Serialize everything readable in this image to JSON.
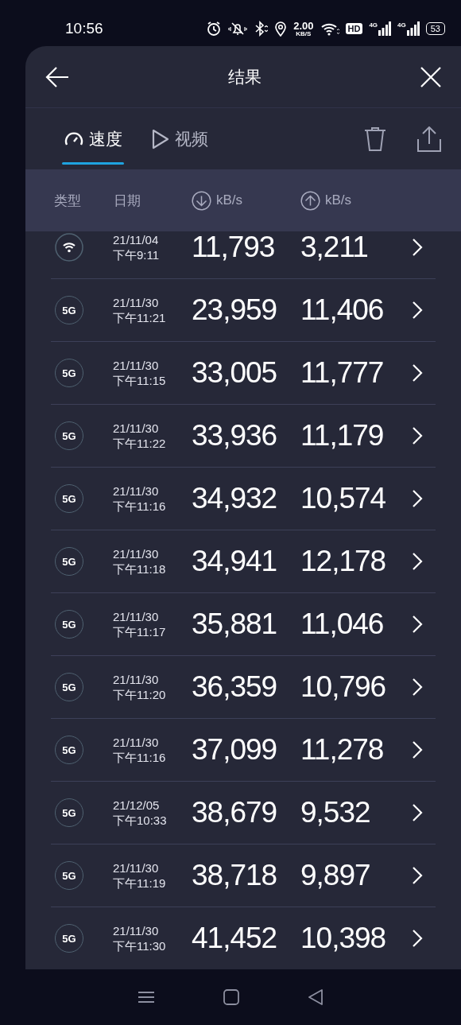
{
  "status_bar": {
    "time": "10:56",
    "net_speed": "2.00",
    "net_speed_unit": "KB/S",
    "hd_badge": "HD",
    "signals": [
      "4G",
      "4G"
    ],
    "battery": "53"
  },
  "header": {
    "title": "结果"
  },
  "tabs": [
    {
      "label": "速度",
      "kind": "gauge",
      "selected": true
    },
    {
      "label": "视频",
      "kind": "play",
      "selected": false
    }
  ],
  "columns": [
    {
      "label": "类型"
    },
    {
      "label": "日期"
    },
    {
      "label": "kB/s",
      "kind": "down"
    },
    {
      "label": "kB/s",
      "kind": "up"
    }
  ],
  "rows": [
    {
      "kind": "wifi",
      "date": "21/11/04",
      "time": "下午9:11",
      "download": "11,793",
      "upload": "3,211"
    },
    {
      "kind": "cellular",
      "badge": "5G",
      "date": "21/11/30",
      "time": "下午11:21",
      "download": "23,959",
      "upload": "11,406"
    },
    {
      "kind": "cellular",
      "badge": "5G",
      "date": "21/11/30",
      "time": "下午11:15",
      "download": "33,005",
      "upload": "11,777"
    },
    {
      "kind": "cellular",
      "badge": "5G",
      "date": "21/11/30",
      "time": "下午11:22",
      "download": "33,936",
      "upload": "11,179"
    },
    {
      "kind": "cellular",
      "badge": "5G",
      "date": "21/11/30",
      "time": "下午11:16",
      "download": "34,932",
      "upload": "10,574"
    },
    {
      "kind": "cellular",
      "badge": "5G",
      "date": "21/11/30",
      "time": "下午11:18",
      "download": "34,941",
      "upload": "12,178"
    },
    {
      "kind": "cellular",
      "badge": "5G",
      "date": "21/11/30",
      "time": "下午11:17",
      "download": "35,881",
      "upload": "11,046"
    },
    {
      "kind": "cellular",
      "badge": "5G",
      "date": "21/11/30",
      "time": "下午11:20",
      "download": "36,359",
      "upload": "10,796"
    },
    {
      "kind": "cellular",
      "badge": "5G",
      "date": "21/11/30",
      "time": "下午11:16",
      "download": "37,099",
      "upload": "11,278"
    },
    {
      "kind": "cellular",
      "badge": "5G",
      "date": "21/12/05",
      "time": "下午10:33",
      "download": "38,679",
      "upload": "9,532"
    },
    {
      "kind": "cellular",
      "badge": "5G",
      "date": "21/11/30",
      "time": "下午11:19",
      "download": "38,718",
      "upload": "9,897"
    },
    {
      "kind": "cellular",
      "badge": "5G",
      "date": "21/11/30",
      "time": "下午11:30",
      "download": "41,452",
      "upload": "10,398"
    }
  ]
}
